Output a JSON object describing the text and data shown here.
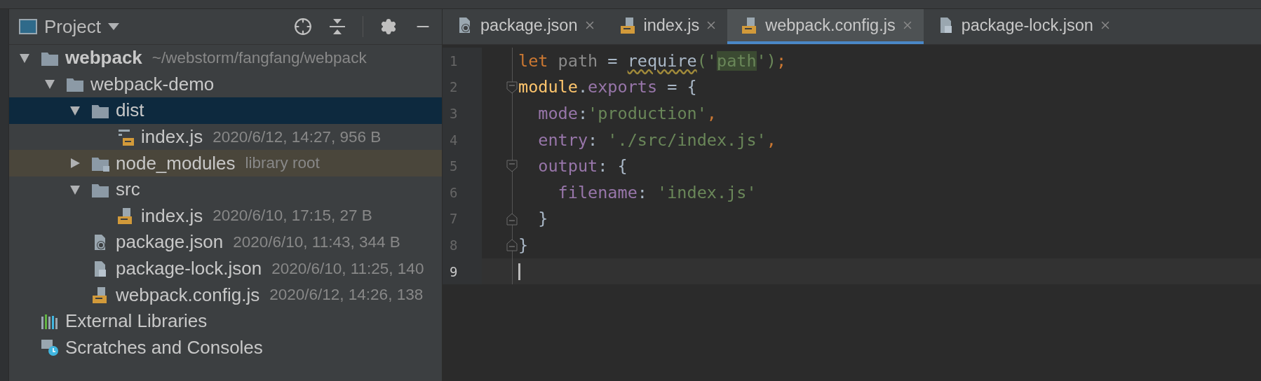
{
  "project_panel": {
    "title": "Project",
    "tree": [
      {
        "name": "webpack",
        "meta": "~/webstorm/fangfang/webpack",
        "kind": "folder",
        "root": true,
        "expanded": true,
        "selected": false,
        "library_root": false,
        "children": [
          {
            "name": "webpack-demo",
            "kind": "folder",
            "root": false,
            "expanded": true,
            "selected": false,
            "library_root": false,
            "children": [
              {
                "name": "dist",
                "kind": "folder",
                "root": false,
                "expanded": true,
                "selected": true,
                "library_root": false,
                "children": [
                  {
                    "name": "index.js",
                    "meta": "2020/6/12, 14:27, 956 B",
                    "kind": "binary-js",
                    "root": false,
                    "selected": false,
                    "library_root": false
                  }
                ]
              },
              {
                "name": "node_modules",
                "meta": "library root",
                "kind": "folder-locked",
                "root": false,
                "expanded": false,
                "selected": false,
                "library_root": true
              },
              {
                "name": "src",
                "kind": "folder",
                "root": false,
                "expanded": true,
                "selected": false,
                "library_root": false,
                "children": [
                  {
                    "name": "index.js",
                    "meta": "2020/6/10, 17:15, 27 B",
                    "kind": "js",
                    "root": false,
                    "selected": false,
                    "library_root": false
                  }
                ]
              },
              {
                "name": "package.json",
                "meta": "2020/6/10, 11:43, 344 B",
                "kind": "json",
                "root": false,
                "selected": false,
                "library_root": false
              },
              {
                "name": "package-lock.json",
                "meta": "2020/6/10, 11:25, 140",
                "kind": "json-locked",
                "root": false,
                "selected": false,
                "library_root": false
              },
              {
                "name": "webpack.config.js",
                "meta": "2020/6/12, 14:26, 138",
                "kind": "js",
                "root": false,
                "selected": false,
                "library_root": false
              }
            ]
          }
        ]
      },
      {
        "name": "External Libraries",
        "kind": "libraries",
        "root": false,
        "selected": false,
        "library_root": false
      },
      {
        "name": "Scratches and Consoles",
        "kind": "scratches",
        "root": false,
        "selected": false,
        "library_root": false
      }
    ]
  },
  "tabs": [
    {
      "label": "package.json",
      "kind": "json",
      "selected": false
    },
    {
      "label": "index.js",
      "kind": "js",
      "selected": false
    },
    {
      "label": "webpack.config.js",
      "kind": "js",
      "selected": true
    },
    {
      "label": "package-lock.json",
      "kind": "json-locked",
      "selected": false
    }
  ],
  "editor": {
    "lines": [
      {
        "number": "1",
        "current": false,
        "fold_start": false,
        "fold_end": false,
        "tokens": [
          {
            "text": "let ",
            "kind": "keyword"
          },
          {
            "text": "path",
            "kind": "unused"
          },
          {
            "text": " = ",
            "kind": "punct"
          },
          {
            "text": "require",
            "kind": "warn"
          },
          {
            "text": "('",
            "kind": "string-punct"
          },
          {
            "text": "path",
            "kind": "string-usage"
          },
          {
            "text": "')",
            "kind": "string-punct"
          },
          {
            "text": ";",
            "kind": "sep"
          }
        ]
      },
      {
        "number": "2",
        "current": false,
        "fold_start": true,
        "fold_end": false,
        "tokens": [
          {
            "text": "module",
            "kind": "global"
          },
          {
            "text": ".",
            "kind": "punct"
          },
          {
            "text": "exports",
            "kind": "prop"
          },
          {
            "text": " = {",
            "kind": "punct"
          }
        ]
      },
      {
        "number": "3",
        "current": false,
        "fold_start": false,
        "fold_end": false,
        "tokens": [
          {
            "text": "  mode",
            "kind": "prop"
          },
          {
            "text": ":",
            "kind": "punct"
          },
          {
            "text": "'production'",
            "kind": "string"
          },
          {
            "text": ",",
            "kind": "sep"
          }
        ]
      },
      {
        "number": "4",
        "current": false,
        "fold_start": false,
        "fold_end": false,
        "tokens": [
          {
            "text": "  entry",
            "kind": "prop"
          },
          {
            "text": ": ",
            "kind": "punct"
          },
          {
            "text": "'./src/index.js'",
            "kind": "string"
          },
          {
            "text": ",",
            "kind": "sep"
          }
        ]
      },
      {
        "number": "5",
        "current": false,
        "fold_start": true,
        "fold_end": false,
        "tokens": [
          {
            "text": "  output",
            "kind": "prop"
          },
          {
            "text": ": {",
            "kind": "punct"
          }
        ]
      },
      {
        "number": "6",
        "current": false,
        "fold_start": false,
        "fold_end": false,
        "tokens": [
          {
            "text": "    filename",
            "kind": "prop"
          },
          {
            "text": ": ",
            "kind": "punct"
          },
          {
            "text": "'index.js'",
            "kind": "string"
          }
        ]
      },
      {
        "number": "7",
        "current": false,
        "fold_start": false,
        "fold_end": true,
        "tokens": [
          {
            "text": "  }",
            "kind": "punct"
          }
        ]
      },
      {
        "number": "8",
        "current": false,
        "fold_start": false,
        "fold_end": true,
        "tokens": [
          {
            "text": "}",
            "kind": "punct"
          }
        ]
      },
      {
        "number": "9",
        "current": true,
        "fold_start": false,
        "fold_end": false
      }
    ]
  }
}
